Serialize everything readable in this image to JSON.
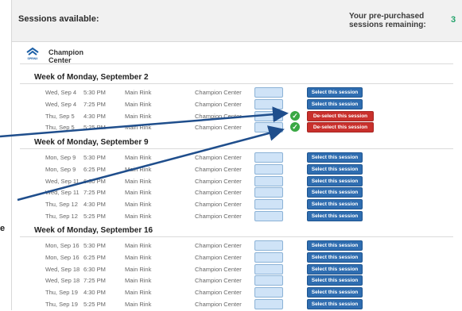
{
  "header": {
    "title": "Sessions available:",
    "remaining_label": "Your pre-purchased sessions remaining:",
    "remaining_count": "3"
  },
  "center": {
    "name": "Champion Center",
    "logo_text": "SPRINX"
  },
  "weeks": [
    {
      "title": "Week of Monday, September 2",
      "sessions": [
        {
          "day": "Wed, Sep 4",
          "time": "5:30 PM",
          "rink": "Main Rink",
          "center": "Champion Center",
          "selected": false,
          "button": "Select this session"
        },
        {
          "day": "Wed, Sep 4",
          "time": "7:25 PM",
          "rink": "Main Rink",
          "center": "Champion Center",
          "selected": false,
          "button": "Select this session"
        },
        {
          "day": "Thu, Sep 5",
          "time": "4:30 PM",
          "rink": "Main Rink",
          "center": "Champion Center",
          "selected": true,
          "button": "De-select this session"
        },
        {
          "day": "Thu, Sep 5",
          "time": "5:25 PM",
          "rink": "Main Rink",
          "center": "Champion Center",
          "selected": true,
          "button": "De-select this session"
        }
      ]
    },
    {
      "title": "Week of Monday, September 9",
      "sessions": [
        {
          "day": "Mon, Sep 9",
          "time": "5:30 PM",
          "rink": "Main Rink",
          "center": "Champion Center",
          "selected": false,
          "button": "Select this session"
        },
        {
          "day": "Mon, Sep 9",
          "time": "6:25 PM",
          "rink": "Main Rink",
          "center": "Champion Center",
          "selected": false,
          "button": "Select this session"
        },
        {
          "day": "Wed, Sep 11",
          "time": "6:30 PM",
          "rink": "Main Rink",
          "center": "Champion Center",
          "selected": false,
          "button": "Select this session"
        },
        {
          "day": "Wed, Sep 11",
          "time": "7:25 PM",
          "rink": "Main Rink",
          "center": "Champion Center",
          "selected": false,
          "button": "Select this session"
        },
        {
          "day": "Thu, Sep 12",
          "time": "4:30 PM",
          "rink": "Main Rink",
          "center": "Champion Center",
          "selected": false,
          "button": "Select this session"
        },
        {
          "day": "Thu, Sep 12",
          "time": "5:25 PM",
          "rink": "Main Rink",
          "center": "Champion Center",
          "selected": false,
          "button": "Select this session"
        }
      ]
    },
    {
      "title": "Week of Monday, September 16",
      "sessions": [
        {
          "day": "Mon, Sep 16",
          "time": "5:30 PM",
          "rink": "Main Rink",
          "center": "Champion Center",
          "selected": false,
          "button": "Select this session"
        },
        {
          "day": "Mon, Sep 16",
          "time": "6:25 PM",
          "rink": "Main Rink",
          "center": "Champion Center",
          "selected": false,
          "button": "Select this session"
        },
        {
          "day": "Wed, Sep 18",
          "time": "6:30 PM",
          "rink": "Main Rink",
          "center": "Champion Center",
          "selected": false,
          "button": "Select this session"
        },
        {
          "day": "Wed, Sep 18",
          "time": "7:25 PM",
          "rink": "Main Rink",
          "center": "Champion Center",
          "selected": false,
          "button": "Select this session"
        },
        {
          "day": "Thu, Sep 19",
          "time": "4:30 PM",
          "rink": "Main Rink",
          "center": "Champion Center",
          "selected": false,
          "button": "Select this session"
        },
        {
          "day": "Thu, Sep 19",
          "time": "5:25 PM",
          "rink": "Main Rink",
          "center": "Champion Center",
          "selected": false,
          "button": "Select this session"
        }
      ]
    }
  ],
  "edge_text": "e",
  "colors": {
    "select_button": "#2f6db0",
    "deselect_button": "#c9302c",
    "check": "#3aa844",
    "count": "#23a36b",
    "arrow": "#1f4e8c"
  }
}
